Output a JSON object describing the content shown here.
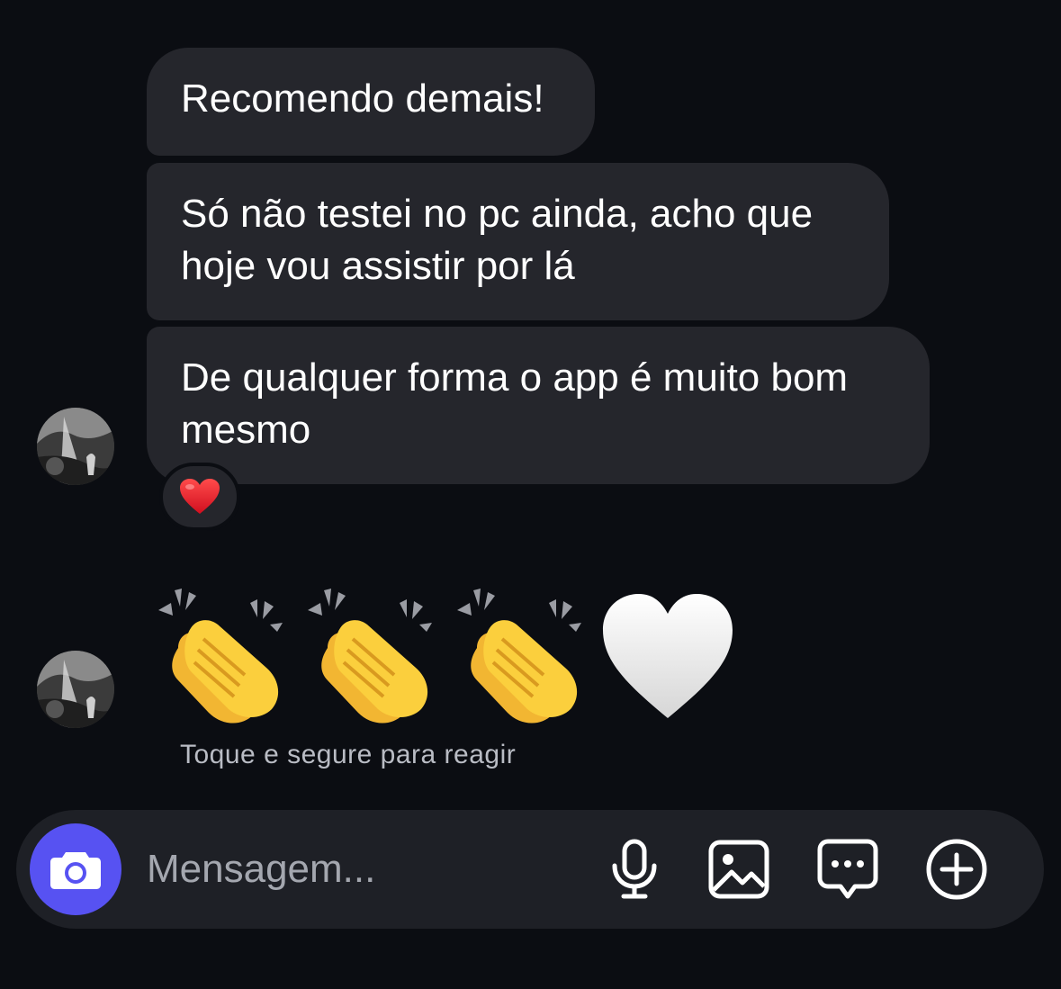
{
  "messages": [
    {
      "text": "Recomendo demais!"
    },
    {
      "text": "Só não testei no pc ainda, acho que hoje vou assistir por lá"
    },
    {
      "text": "De qualquer forma o app é muito bom mesmo",
      "reaction": "heart-icon"
    }
  ],
  "emoji_message": {
    "emojis": [
      "clapping-hands-icon",
      "clapping-hands-icon",
      "clapping-hands-icon",
      "white-heart-icon"
    ]
  },
  "hint": "Toque e segure para reagir",
  "composer": {
    "placeholder": "Mensagem...",
    "camera_icon": "camera-icon",
    "tools": [
      "microphone-icon",
      "gallery-icon",
      "sticker-chat-icon",
      "plus-circle-icon"
    ]
  },
  "colors": {
    "background": "#0b0d12",
    "bubble": "#25262c",
    "composer": "#1e2026",
    "accent": "#5752f2",
    "hint_text": "#b9bcc4"
  }
}
